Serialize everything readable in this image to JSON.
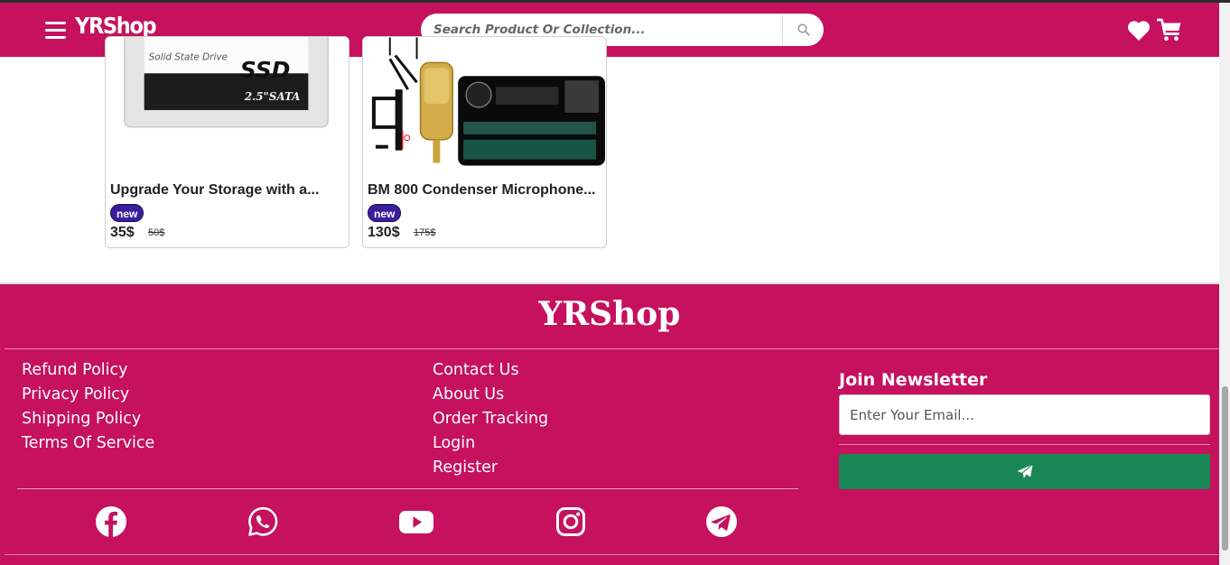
{
  "header": {
    "logo": "YRShop",
    "search_placeholder": "Search Product Or Collection...",
    "icons": [
      "menu-icon",
      "search-icon",
      "heart-icon",
      "cart-icon"
    ]
  },
  "products": [
    {
      "title": "Upgrade Your Storage with a...",
      "badge": "new",
      "price": "35$",
      "old_price": "50$",
      "image_text": {
        "line1": "Solid State Drive",
        "line2": "SSD",
        "line3": "2.5\"SATA"
      }
    },
    {
      "title": "BM 800 Condenser Microphone...",
      "badge": "new",
      "price": "130$",
      "old_price": "175$"
    }
  ],
  "footer": {
    "logo": "YRShop",
    "policy_links": [
      "Refund Policy",
      "Privacy Policy",
      "Shipping Policy",
      "Terms Of Service"
    ],
    "info_links": [
      "Contact Us",
      "About Us",
      "Order Tracking",
      "Login",
      "Register"
    ],
    "newsletter": {
      "title": "Join Newsletter",
      "placeholder": "Enter Your Email..."
    },
    "social": [
      "facebook-icon",
      "whatsapp-icon",
      "youtube-icon",
      "instagram-icon",
      "telegram-icon"
    ]
  },
  "colors": {
    "brand": "#c5115e",
    "badge": "#3b1e9e",
    "send_button": "#198754"
  }
}
